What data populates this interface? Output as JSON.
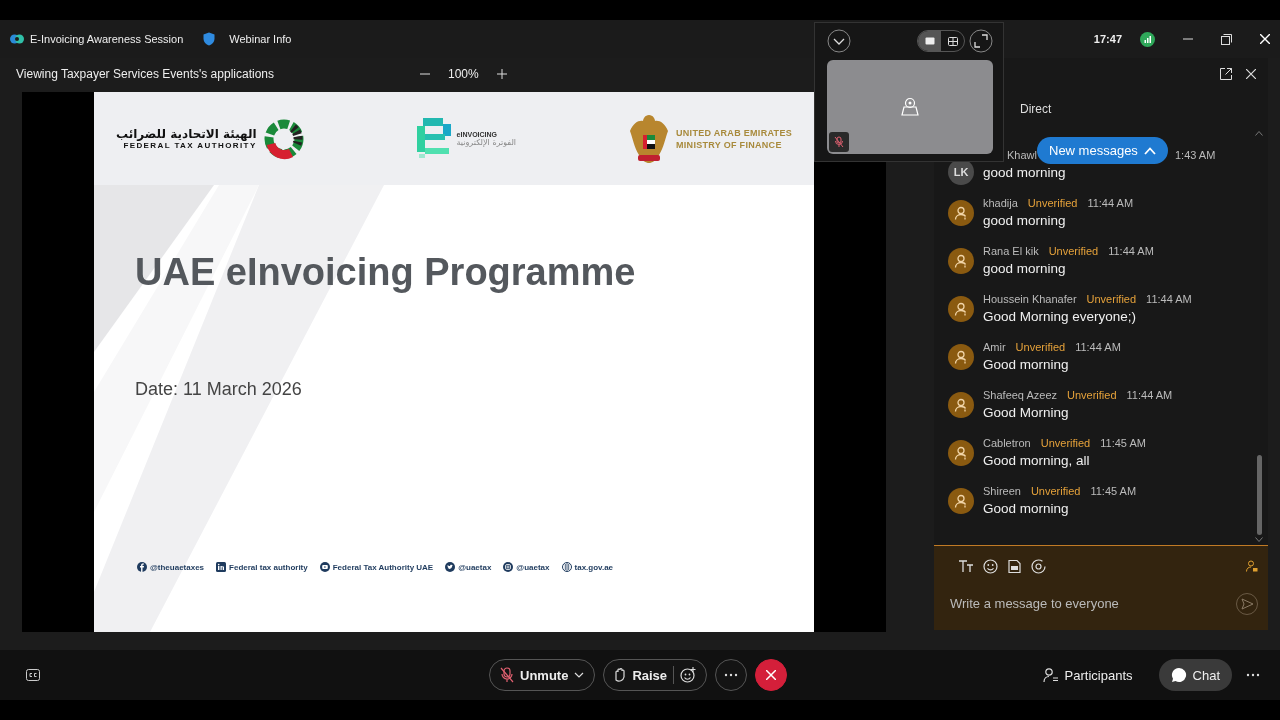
{
  "window": {
    "title": "E-Invoicing Awareness Session",
    "info_button": "Webinar Info",
    "clock": "17:47"
  },
  "share_bar": {
    "label": "Viewing Taxpayer Services Events's applications",
    "zoom": "100%"
  },
  "slide": {
    "fta_arabic": "الهيئة الاتحادية للضرائب",
    "fta_name": "FEDERAL TAX AUTHORITY",
    "einvoicing_name": "eINVOICING",
    "einvoicing_arabic": "الفوترة الإلكترونية",
    "mof_lines": [
      "UNITED ARAB EMIRATES",
      "MINISTRY OF FINANCE"
    ],
    "title": "UAE eInvoicing Programme",
    "date": "Date: 11 March 2026",
    "social": [
      {
        "kind": "facebook",
        "label": "@theuaetaxes"
      },
      {
        "kind": "linkedin",
        "label": "Federal tax authority"
      },
      {
        "kind": "youtube",
        "label": "Federal Tax Authority UAE"
      },
      {
        "kind": "twitter",
        "label": "@uaetax"
      },
      {
        "kind": "instagram",
        "label": "@uaetax"
      },
      {
        "kind": "web",
        "label": "tax.gov.ae"
      }
    ]
  },
  "video_panel": {
    "layouts": [
      {
        "kind": "single",
        "selected": true
      },
      {
        "kind": "grid",
        "selected": false
      }
    ]
  },
  "chat": {
    "tabs": [
      {
        "label": "Direct",
        "selected": false
      }
    ],
    "new_messages": "New messages",
    "placeholder": "Write a message to everyone",
    "messages": [
      {
        "kind": "initials",
        "initials": "LK",
        "sender": "Khawl",
        "time": "1:43 AM",
        "text": "good morning"
      },
      {
        "kind": "guest",
        "sender": "khadija",
        "status": "Unverified",
        "time": "11:44 AM",
        "text": "good morning"
      },
      {
        "kind": "guest",
        "sender": "Rana El kik",
        "status": "Unverified",
        "time": "11:44 AM",
        "text": "good morning"
      },
      {
        "kind": "guest",
        "sender": "Houssein Khanafer",
        "status": "Unverified",
        "time": "11:44 AM",
        "text": "Good Morning everyone;)"
      },
      {
        "kind": "guest",
        "sender": "Amir",
        "status": "Unverified",
        "time": "11:44 AM",
        "text": "Good morning"
      },
      {
        "kind": "guest",
        "sender": "Shafeeq Azeez",
        "status": "Unverified",
        "time": "11:44 AM",
        "text": "Good Morning"
      },
      {
        "kind": "guest",
        "sender": "Cabletron",
        "status": "Unverified",
        "time": "11:45 AM",
        "text": "Good morning, all"
      },
      {
        "kind": "guest",
        "sender": "Shireen",
        "status": "Unverified",
        "time": "11:45 AM",
        "text": "Good morning"
      }
    ]
  },
  "controls": {
    "unmute": "Unmute",
    "raise": "Raise",
    "participants": "Participants",
    "chat": {
      "label": "Chat",
      "selected": true
    }
  }
}
